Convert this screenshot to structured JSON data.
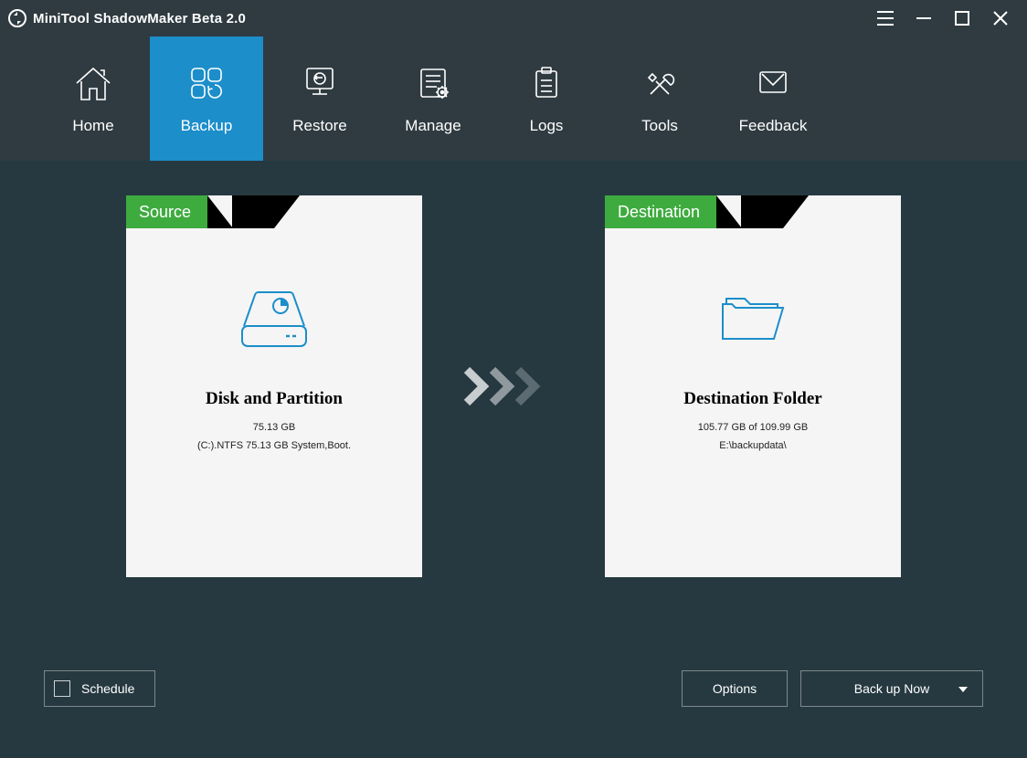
{
  "window": {
    "title": "MiniTool ShadowMaker Beta 2.0"
  },
  "nav": {
    "items": [
      {
        "label": "Home"
      },
      {
        "label": "Backup"
      },
      {
        "label": "Restore"
      },
      {
        "label": "Manage"
      },
      {
        "label": "Logs"
      },
      {
        "label": "Tools"
      },
      {
        "label": "Feedback"
      }
    ],
    "active_index": 1
  },
  "source_panel": {
    "tab": "Source",
    "title": "Disk and Partition",
    "line1": "75.13 GB",
    "line2": "(C:).NTFS 75.13 GB System,Boot."
  },
  "destination_panel": {
    "tab": "Destination",
    "title": "Destination Folder",
    "line1": "105.77 GB of 109.99 GB",
    "line2": "E:\\backupdata\\"
  },
  "footer": {
    "schedule": "Schedule",
    "options": "Options",
    "backup_now": "Back up Now"
  }
}
